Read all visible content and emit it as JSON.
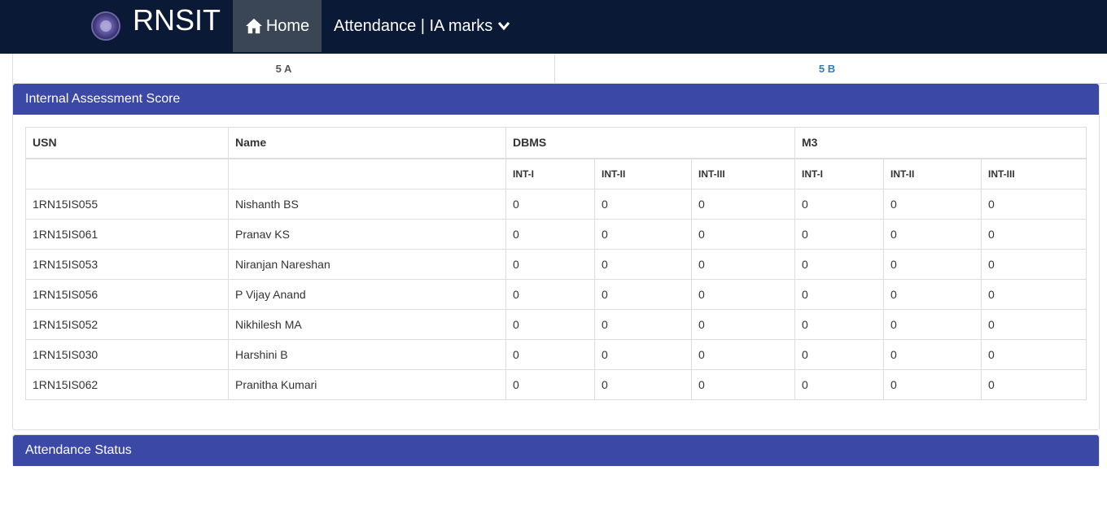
{
  "navbar": {
    "brand": "RNSIT",
    "home_label": "Home",
    "dropdown_label": "Attendance | IA marks"
  },
  "tabs": [
    {
      "label": "5 A",
      "active": true
    },
    {
      "label": "5 B",
      "active": false
    }
  ],
  "ia_panel": {
    "title": "Internal Assessment Score",
    "headers": {
      "usn": "USN",
      "name": "Name",
      "subjects": [
        "DBMS",
        "M3"
      ],
      "sub_cols": [
        "INT-I",
        "INT-II",
        "INT-III",
        "INT-I",
        "INT-II",
        "INT-III"
      ]
    },
    "rows": [
      {
        "usn": "1RN15IS055",
        "name": "Nishanth BS",
        "marks": [
          "0",
          "0",
          "0",
          "0",
          "0",
          "0"
        ]
      },
      {
        "usn": "1RN15IS061",
        "name": "Pranav KS",
        "marks": [
          "0",
          "0",
          "0",
          "0",
          "0",
          "0"
        ]
      },
      {
        "usn": "1RN15IS053",
        "name": "Niranjan Nareshan",
        "marks": [
          "0",
          "0",
          "0",
          "0",
          "0",
          "0"
        ]
      },
      {
        "usn": "1RN15IS056",
        "name": "P Vijay Anand",
        "marks": [
          "0",
          "0",
          "0",
          "0",
          "0",
          "0"
        ]
      },
      {
        "usn": "1RN15IS052",
        "name": "Nikhilesh MA",
        "marks": [
          "0",
          "0",
          "0",
          "0",
          "0",
          "0"
        ]
      },
      {
        "usn": "1RN15IS030",
        "name": "Harshini B",
        "marks": [
          "0",
          "0",
          "0",
          "0",
          "0",
          "0"
        ]
      },
      {
        "usn": "1RN15IS062",
        "name": "Pranitha Kumari",
        "marks": [
          "0",
          "0",
          "0",
          "0",
          "0",
          "0"
        ]
      }
    ]
  },
  "attendance_panel": {
    "title": "Attendance Status"
  },
  "colors": {
    "navbar": "#0a1a36",
    "nav_active": "#3a4556",
    "panel_heading": "#3b48a6",
    "tab_link": "#337ab7"
  },
  "icons": {
    "home": "home-icon",
    "dropdown": "chevron-down-icon",
    "logo": "college-seal-logo"
  }
}
